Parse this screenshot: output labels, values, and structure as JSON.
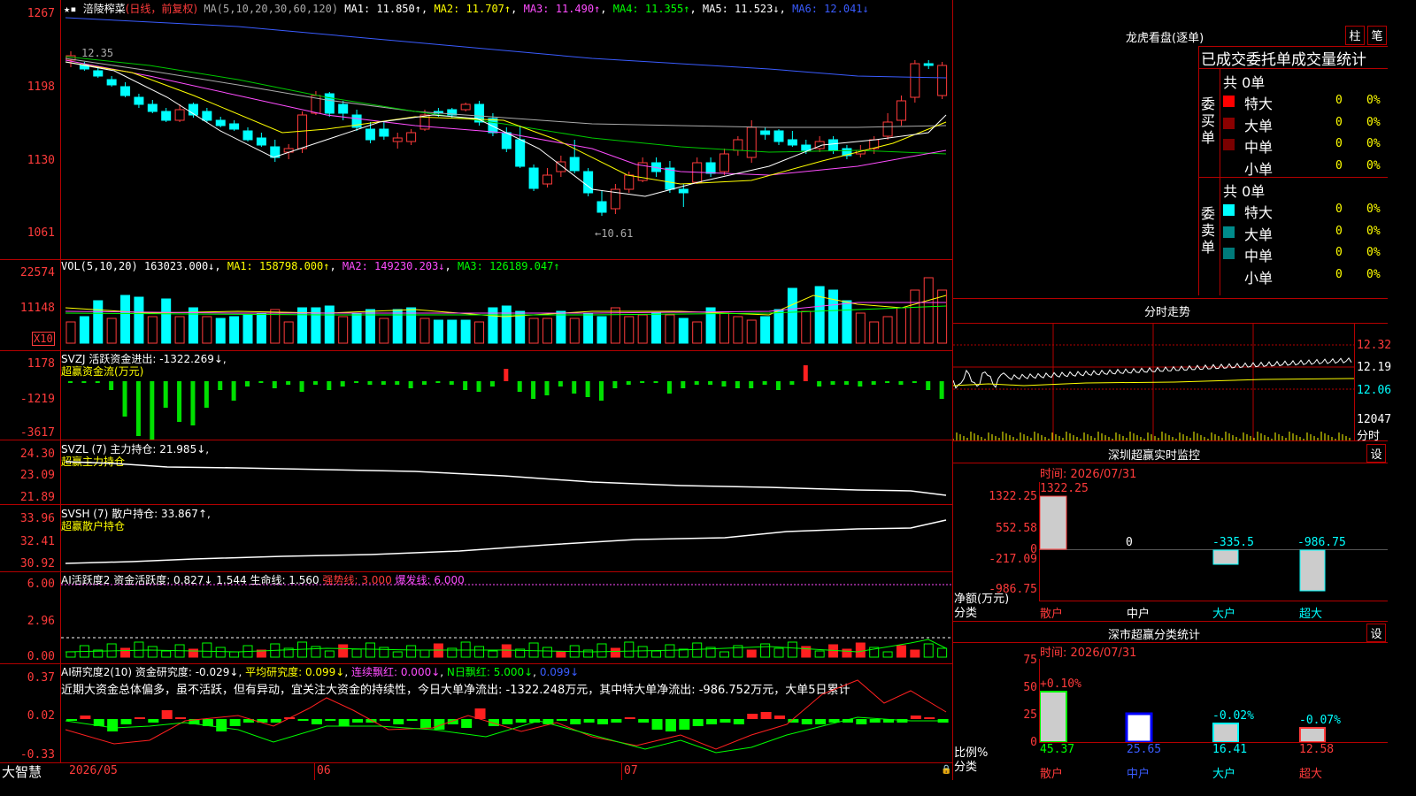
{
  "colors": {
    "red": "#ff3b3b",
    "cyan": "#00ffff",
    "yellow": "#ffff00",
    "magenta": "#ff4dff",
    "green": "#00ff00",
    "blue": "#3a5cff",
    "grid": "#b40000"
  },
  "main": {
    "stock_name": "涪陵榨菜",
    "period": "(日线，前复权)",
    "ma_label": "MA(5,10,20,30,60,120)",
    "ma1": "MA1: 11.850↑",
    "ma2": "MA2: 11.707↑",
    "ma3": "MA3: 11.490↑",
    "ma4": "MA4: 11.355↑",
    "ma5": "MA5: 11.523↓",
    "ma6": "MA6: 12.041↓",
    "y_ticks": [
      "1267",
      "1198",
      "1130",
      "1061"
    ],
    "high_label": "12.35",
    "low_label": "←10.61"
  },
  "vol": {
    "title": "VOL(5,10,20)",
    "value": "163023.000↓",
    "ma1": "MA1: 158798.000↑",
    "ma2": "MA2: 149230.203↓",
    "ma3": "MA3: 126189.047↑",
    "y_ticks": [
      "22574",
      "11148"
    ],
    "unit": "X10"
  },
  "svzj": {
    "title": "SVZJ  活跃资金进出: -1322.269↓,",
    "sub": "超赢资金流(万元)",
    "y_ticks": [
      "1178",
      "-1219",
      "-3617"
    ]
  },
  "svzl": {
    "title": "SVZL (7) 主力持仓: 21.985↓,",
    "sub": "超赢主力持仓",
    "y_ticks": [
      "24.30",
      "23.09",
      "21.89"
    ]
  },
  "svsh": {
    "title": "SVSH (7) 散户持仓: 33.867↑,",
    "sub": "超赢散户持仓",
    "y_ticks": [
      "33.96",
      "32.41",
      "30.92"
    ]
  },
  "ai1": {
    "t1": "AI活跃度2 资金活跃度: 0.827↓ 1.544 生命线: 1.560",
    "t2": " 强势线: 3.000",
    "t3": " 爆发线: 6.000",
    "y_ticks": [
      "6.00",
      "2.96",
      "0.00"
    ]
  },
  "ai2": {
    "t1": "AI研究度2(10) 资金研究度: -0.029↓",
    "t2": " 平均研究度: 0.099↓",
    "t3": " 连续飘红: 0.000↓",
    "t4": " N日飘红: 5.000↓",
    "t5": " 0.099↓",
    "note": "近期大资金总体偏多，虽不活跃，但有异动，宜关注大资金的持续性，今日大单净流出: -1322.248万元，其中特大单净流出: -986.752万元，大单5日累计",
    "y_ticks": [
      "0.37",
      "0.02",
      "-0.33"
    ]
  },
  "xaxis": {
    "brand": "大智慧",
    "d1": "2026/05",
    "d2": "06",
    "d3": "07"
  },
  "right": {
    "lh_title": "龙虎看盘(逐单)",
    "btn1": "柱",
    "btn2": "笔",
    "stat_title": "已成交委托单成交量统计",
    "buy_label": "委买单",
    "sell_label": "委卖单",
    "buy_total": "共 0单",
    "sell_total": "共 0单",
    "buy_rows": [
      {
        "name": "特大",
        "n": "0",
        "p": "0%"
      },
      {
        "name": "大单",
        "n": "0",
        "p": "0%"
      },
      {
        "name": "中单",
        "n": "0",
        "p": "0%"
      },
      {
        "name": "小单",
        "n": "0",
        "p": "0%"
      }
    ],
    "sell_rows": [
      {
        "name": "特大",
        "n": "0",
        "p": "0%"
      },
      {
        "name": "大单",
        "n": "0",
        "p": "0%"
      },
      {
        "name": "中单",
        "n": "0",
        "p": "0%"
      },
      {
        "name": "小单",
        "n": "0",
        "p": "0%"
      }
    ],
    "fs_title": "分时走势",
    "fs_prices": [
      "12.32",
      "12.19",
      "12.06"
    ],
    "fs_vol": "12047",
    "fs_vol_unit": "分时",
    "mon_title": "深圳超赢实时监控",
    "mon_set": "设",
    "mon_time": "时间: 2026/07/31",
    "mon_y": [
      "1322.25",
      "552.58",
      "0",
      "-217.09",
      "-986.75"
    ],
    "mon_vals": [
      "1322.25",
      "0",
      "-335.5",
      "-986.75"
    ],
    "mon_ylabel": "净额(万元)",
    "mon_xlabel": "分类",
    "cats": [
      "散户",
      "中户",
      "大户",
      "超大"
    ],
    "cls_title": "深市超赢分类统计",
    "cls_set": "设",
    "cls_time": "时间: 2026/07/31",
    "cls_y": [
      "75",
      "50",
      "25",
      "0"
    ],
    "cls_tops": [
      "+0.10%",
      "",
      "-0.02%",
      "-0.07%"
    ],
    "cls_vals": [
      "45.37",
      "25.65",
      "16.41",
      "12.58"
    ],
    "cls_ylabel": "比例%",
    "cls_xlabel": "分类"
  }
}
